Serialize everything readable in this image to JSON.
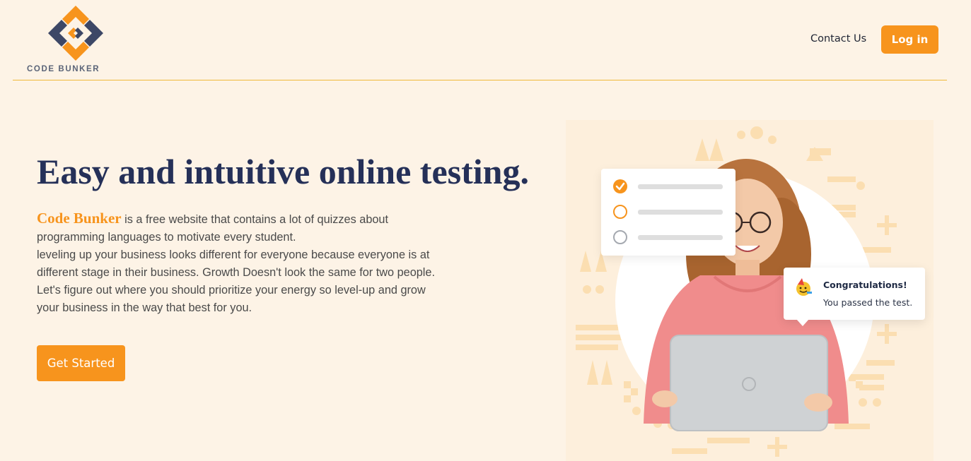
{
  "header": {
    "logo_text": "CODE BUNKER",
    "contact_label": "Contact Us",
    "login_label": "Log in"
  },
  "hero": {
    "title": "Easy and intuitive online testing.",
    "brand_name": "Code Bunker",
    "description_lines": [
      " is a free website that contains a lot of quizzes about",
      "programming languages to motivate every student.",
      "leveling up your business looks different for everyone because everyone is at",
      "different stage in their business. Growth Doesn't look the same for two people.",
      "Let's figure out where you should prioritize your energy so level-up and grow",
      "your business in the way that best for you."
    ],
    "cta_label": "Get Started"
  },
  "illustration": {
    "quiz_items": [
      {
        "state": "checked"
      },
      {
        "state": "selected"
      },
      {
        "state": "unchecked"
      }
    ],
    "toast_icon": "party-face-icon",
    "toast_title": "Congratulations!",
    "toast_message": "You passed the test."
  },
  "colors": {
    "accent": "#f7941d",
    "navy": "#253058",
    "background": "#fdf3e6",
    "divider": "#f0b93a"
  }
}
